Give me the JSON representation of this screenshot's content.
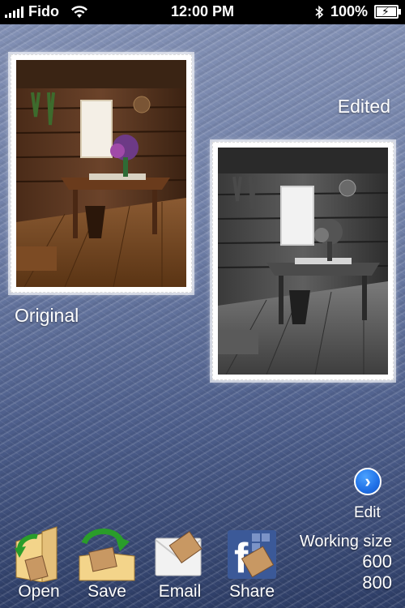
{
  "status_bar": {
    "carrier": "Fido",
    "time": "12:00 PM",
    "battery": "100%"
  },
  "images": {
    "original_label": "Original",
    "edited_label": "Edited"
  },
  "edit": {
    "label": "Edit"
  },
  "toolbar": {
    "items": [
      {
        "label": "Open",
        "icon": "folder-open-icon"
      },
      {
        "label": "Save",
        "icon": "folder-save-icon"
      },
      {
        "label": "Email",
        "icon": "envelope-icon"
      },
      {
        "label": "Share",
        "icon": "facebook-icon"
      }
    ]
  },
  "working_size": {
    "label": "Working size",
    "width": "600",
    "height": "800"
  },
  "colors": {
    "background_top": "#8290b4",
    "background_bottom": "#2e3e67",
    "edit_button": "#1f6fe6",
    "facebook_blue": "#3b5998"
  }
}
